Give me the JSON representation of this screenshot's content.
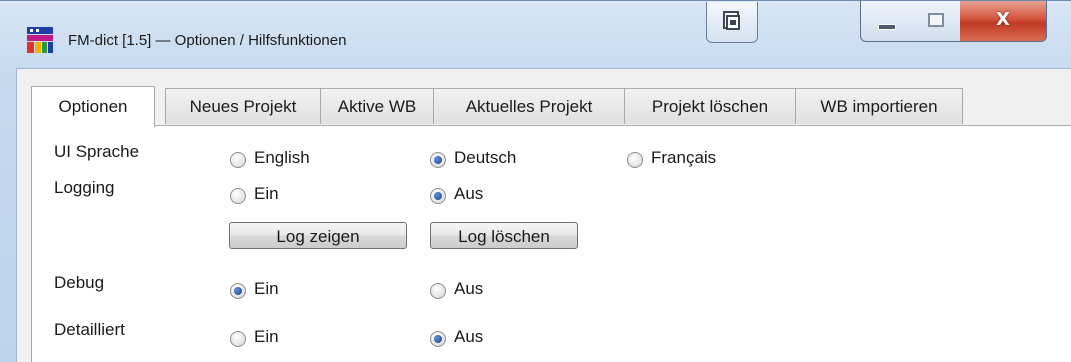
{
  "window": {
    "title": "FM-dict [1.5] — Optionen / Hilfsfunktionen",
    "app_icon": "app-icon",
    "extra_button_icon": "window-switch-icon",
    "caption_buttons": {
      "minimize": "minimize-icon",
      "maximize": "maximize-icon",
      "close_glyph": "X"
    }
  },
  "tabs": [
    {
      "label": "Optionen",
      "active": true
    },
    {
      "label": "Neues Projekt",
      "active": false
    },
    {
      "label": "Aktive WB",
      "active": false
    },
    {
      "label": "Aktuelles Projekt",
      "active": false
    },
    {
      "label": "Projekt löschen",
      "active": false
    },
    {
      "label": "WB importieren",
      "active": false
    }
  ],
  "options": {
    "ui_language": {
      "label": "UI Sprache",
      "choices": [
        "English",
        "Deutsch",
        "Français"
      ],
      "selected": "Deutsch"
    },
    "logging": {
      "label": "Logging",
      "choices": [
        "Ein",
        "Aus"
      ],
      "selected": "Aus",
      "show_log_button": "Log zeigen",
      "clear_log_button": "Log löschen"
    },
    "debug": {
      "label": "Debug",
      "choices": [
        "Ein",
        "Aus"
      ],
      "selected": "Ein"
    },
    "detailed": {
      "label": "Detailliert",
      "choices": [
        "Ein",
        "Aus"
      ],
      "selected": "Aus"
    }
  },
  "colors": {
    "radio_checked": "#1a3f85",
    "close_button": "#c03a23",
    "titlebar": "#c5d9ef"
  }
}
